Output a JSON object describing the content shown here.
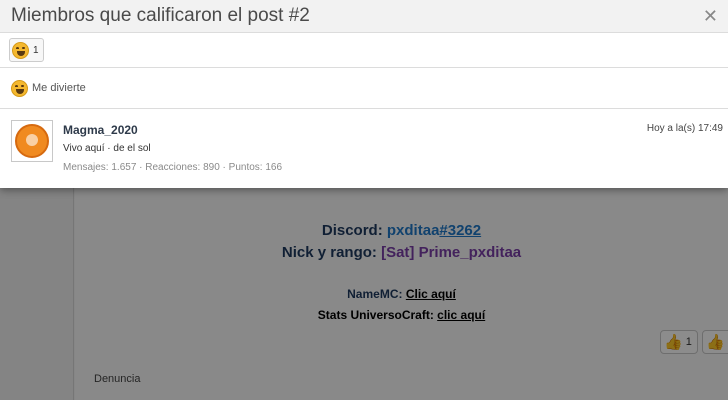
{
  "modal": {
    "title": "Miembros que calificaron el post #2",
    "close_glyph": "✕"
  },
  "reaction_tab": {
    "icon": "laughing-emoji-icon",
    "count": "1"
  },
  "reaction_section": {
    "icon": "laughing-emoji-icon",
    "label": "Me divierte"
  },
  "member": {
    "name": "Magma_2020",
    "title": "Vivo aquí · de el sol",
    "stats": "Mensajes: 1.657 · Reacciones: 890 · Puntos: 166",
    "time": "Hoy a la(s) 17:49"
  },
  "background_post": {
    "discord_label": "Discord: ",
    "discord_user": "pxditaa",
    "discord_tag": "#3262",
    "nick_label": "Nick y rango: ",
    "nick_value": "[Sat] Prime_pxditaa",
    "namemc_label": "NameMC: ",
    "namemc_link": "Clic aquí",
    "stats_label": "Stats UniversoCraft: ",
    "stats_link": "clic aquí",
    "like_count": "1",
    "report_label": "Denuncia"
  }
}
